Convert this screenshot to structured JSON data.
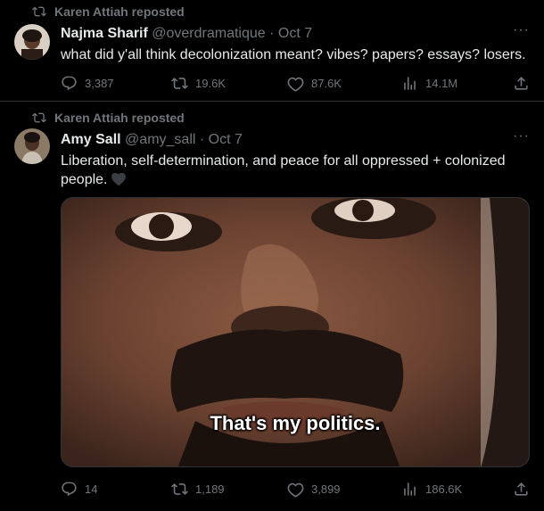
{
  "tweets": [
    {
      "reposted_by": "Karen Attiah reposted",
      "author_name": "Najma Sharif",
      "handle": "@overdramatique",
      "separator": "·",
      "date": "Oct 7",
      "text": "what did y'all think decolonization meant? vibes? papers? essays? losers.",
      "more": "···",
      "replies": "3,387",
      "reposts": "19.6K",
      "likes": "87.6K",
      "views": "14.1M"
    },
    {
      "reposted_by": "Karen Attiah reposted",
      "author_name": "Amy Sall",
      "handle": "@amy_sall",
      "separator": "·",
      "date": "Oct 7",
      "text": "Liberation, self-determination, and peace for all oppressed + colonized people.",
      "more": "···",
      "media_caption": "That's my politics.",
      "replies": "14",
      "reposts": "1,189",
      "likes": "3,899",
      "views": "186.6K"
    }
  ],
  "icons": {
    "repost": "repost-icon",
    "reply": "reply-icon",
    "like": "heart-icon",
    "views": "views-icon",
    "share": "share-icon",
    "more": "more-icon"
  },
  "colors": {
    "background": "#000000",
    "text": "#e7e9ea",
    "muted": "#71767b",
    "divider": "#2f3336"
  }
}
